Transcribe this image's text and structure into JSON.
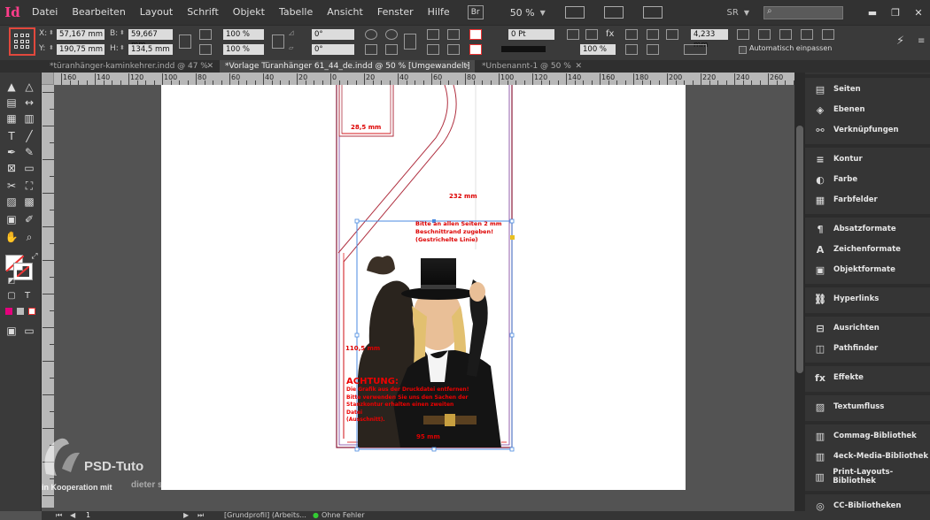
{
  "app": {
    "logo": "Id"
  },
  "menu": [
    "Datei",
    "Bearbeiten",
    "Layout",
    "Schrift",
    "Objekt",
    "Tabelle",
    "Ansicht",
    "Fenster",
    "Hilfe"
  ],
  "menubar": {
    "bridge": "Br",
    "zoom": "50 %",
    "workspace": "SR",
    "search_icon": "⌕"
  },
  "window_controls": {
    "minimize": "▬",
    "maximize": "❐",
    "close": "✕"
  },
  "control": {
    "x_label": "X:",
    "x_value": "57,167 mm",
    "y_label": "Y:",
    "y_value": "190,75 mm",
    "w_label": "B:",
    "w_value": "59,667 mm",
    "h_label": "H:",
    "h_value": "134,5 mm",
    "scale_x": "100 %",
    "scale_y": "100 %",
    "angle": "0°",
    "shear": "0°",
    "stroke_weight": "0 Pt",
    "opacity": "100 %",
    "offset": "4,233 mm",
    "auto_fit": "Automatisch einpassen"
  },
  "tabs": [
    {
      "label": "*türanhänger-kaminkehrer.indd @ 47 %",
      "close": "✕",
      "active": false
    },
    {
      "label": "*Vorlage Türanhänger 61_44_de.indd @ 50 % [Umgewandelt]",
      "close": "✕",
      "active": true
    },
    {
      "label": "*Unbenannt-1 @ 50 %",
      "close": "✕",
      "active": false
    }
  ],
  "ruler": {
    "top_labels": [
      "160",
      "140",
      "120",
      "100",
      "80",
      "60",
      "40",
      "20",
      "0",
      "20",
      "40",
      "60",
      "80",
      "100",
      "120",
      "140",
      "160",
      "180",
      "200",
      "220",
      "240",
      "260"
    ]
  },
  "document": {
    "dim_top": "28,5 mm",
    "dim_right": "232 mm",
    "dim_left": "110,5 mm",
    "dim_bottom": "95 mm",
    "note": [
      "Bitte an allen Seiten 2 mm",
      "Beschnittrand zugeben!",
      "(Gestrichelte Linie)"
    ],
    "warning_title": "ACHTUNG:",
    "warning_lines": [
      "Die Grafik aus der Druckdatei entfernen!",
      "Bitte verwenden Sie uns den Sachen der",
      "Stanzkontur erhalten einen zweiten Datei",
      "(Ausschnitt)."
    ]
  },
  "panels": [
    {
      "label": "Seiten",
      "icon": "▤"
    },
    {
      "label": "Ebenen",
      "icon": "◈"
    },
    {
      "label": "Verknüpfungen",
      "icon": "⚯"
    },
    {
      "label": "Kontur",
      "icon": "≡"
    },
    {
      "label": "Farbe",
      "icon": "◐"
    },
    {
      "label": "Farbfelder",
      "icon": "▦"
    },
    {
      "label": "Absatzformate",
      "icon": "¶"
    },
    {
      "label": "Zeichenformate",
      "icon": "A"
    },
    {
      "label": "Objektformate",
      "icon": "▣"
    },
    {
      "label": "Hyperlinks",
      "icon": "⛓"
    },
    {
      "label": "Ausrichten",
      "icon": "⊟"
    },
    {
      "label": "Pathfinder",
      "icon": "◫"
    },
    {
      "label": "Effekte",
      "icon": "fx"
    },
    {
      "label": "Textumfluss",
      "icon": "▨"
    },
    {
      "label": "Commag-Bibliothek",
      "icon": "▥"
    },
    {
      "label": "4eck-Media-Bibliothek",
      "icon": "▥"
    },
    {
      "label": "Print-Layouts-Bibliothek",
      "icon": "▥"
    },
    {
      "label": "CC-Bibliotheken",
      "icon": "◎"
    }
  ],
  "status": {
    "page": "1",
    "profile": "[Grundprofil] (Arbeits...",
    "preflight": "Ohne Fehler"
  },
  "watermark": {
    "brand": "PSD-Tuto",
    "coop": "in Kooperation mit",
    "partner": "dieter sassmann"
  }
}
